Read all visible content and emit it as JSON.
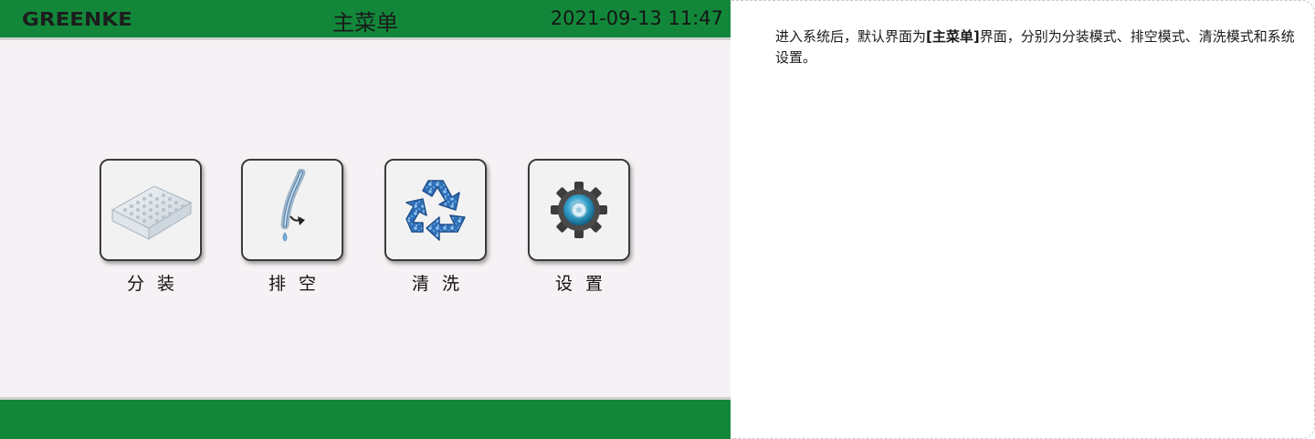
{
  "header": {
    "logo_text": "GREENKE",
    "title": "主菜单",
    "datetime": "2021-09-13 11:47"
  },
  "menu": {
    "items": [
      {
        "label": "分装",
        "icon": "well-plate-icon"
      },
      {
        "label": "排空",
        "icon": "tube-drain-icon"
      },
      {
        "label": "清洗",
        "icon": "recycle-icon"
      },
      {
        "label": "设置",
        "icon": "gear-icon"
      }
    ]
  },
  "description": {
    "prefix": "进入系统后，默认界面为",
    "highlight": "[主菜单]",
    "suffix": "界面，分别为分装模式、排空模式、清洗模式和系统设置。"
  },
  "colors": {
    "header_green": "#12873a",
    "screen_bg": "#f6f1f4"
  }
}
